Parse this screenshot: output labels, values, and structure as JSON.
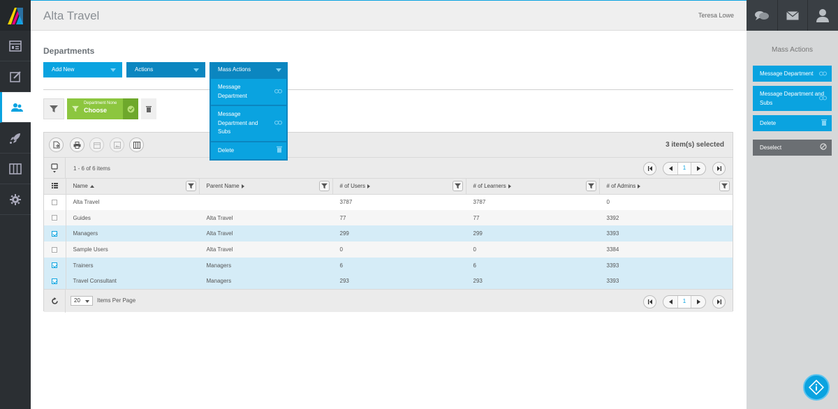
{
  "app": {
    "title": "Alta Travel",
    "user": "Teresa Lowe"
  },
  "nav": {
    "items": [
      "dashboard",
      "edit",
      "users",
      "launch",
      "catalog",
      "settings"
    ],
    "active": "users"
  },
  "page": {
    "title": "Departments"
  },
  "actions": {
    "add_new": "Add New",
    "actions": "Actions",
    "mass_actions": "Mass Actions",
    "mass_menu": [
      "Message Department",
      "Message Department and Subs",
      "Delete"
    ]
  },
  "filter": {
    "chip_small": "Department None",
    "chip_big": "Choose"
  },
  "grid": {
    "selected_text": "3 item(s) selected",
    "count_text": "1 - 6 of 6 items",
    "page": "1",
    "columns": [
      "Name",
      "Parent Name",
      "# of Users",
      "# of Learners",
      "# of Admins"
    ],
    "rows": [
      {
        "name": "Alta Travel",
        "parent": "",
        "users": "3787",
        "learners": "3787",
        "admins": "0",
        "selected": false
      },
      {
        "name": "Guides",
        "parent": "Alta Travel",
        "users": "77",
        "learners": "77",
        "admins": "3392",
        "selected": false
      },
      {
        "name": "Managers",
        "parent": "Alta Travel",
        "users": "299",
        "learners": "299",
        "admins": "3393",
        "selected": true
      },
      {
        "name": "Sample Users",
        "parent": "Alta Travel",
        "users": "0",
        "learners": "0",
        "admins": "3384",
        "selected": false
      },
      {
        "name": "Trainers",
        "parent": "Managers",
        "users": "6",
        "learners": "6",
        "admins": "3393",
        "selected": true
      },
      {
        "name": "Travel Consultant",
        "parent": "Managers",
        "users": "293",
        "learners": "293",
        "admins": "3393",
        "selected": true
      }
    ],
    "items_per_page": "20",
    "items_per_page_label": "Items Per Page"
  },
  "right_panel": {
    "title": "Mass Actions",
    "buttons": [
      "Message Department",
      "Message Department and Subs",
      "Delete"
    ],
    "deselect": "Deselect"
  },
  "colors": {
    "accent": "#0aa3e0",
    "green": "#8cc63f",
    "sidebar": "#2b2f33"
  }
}
